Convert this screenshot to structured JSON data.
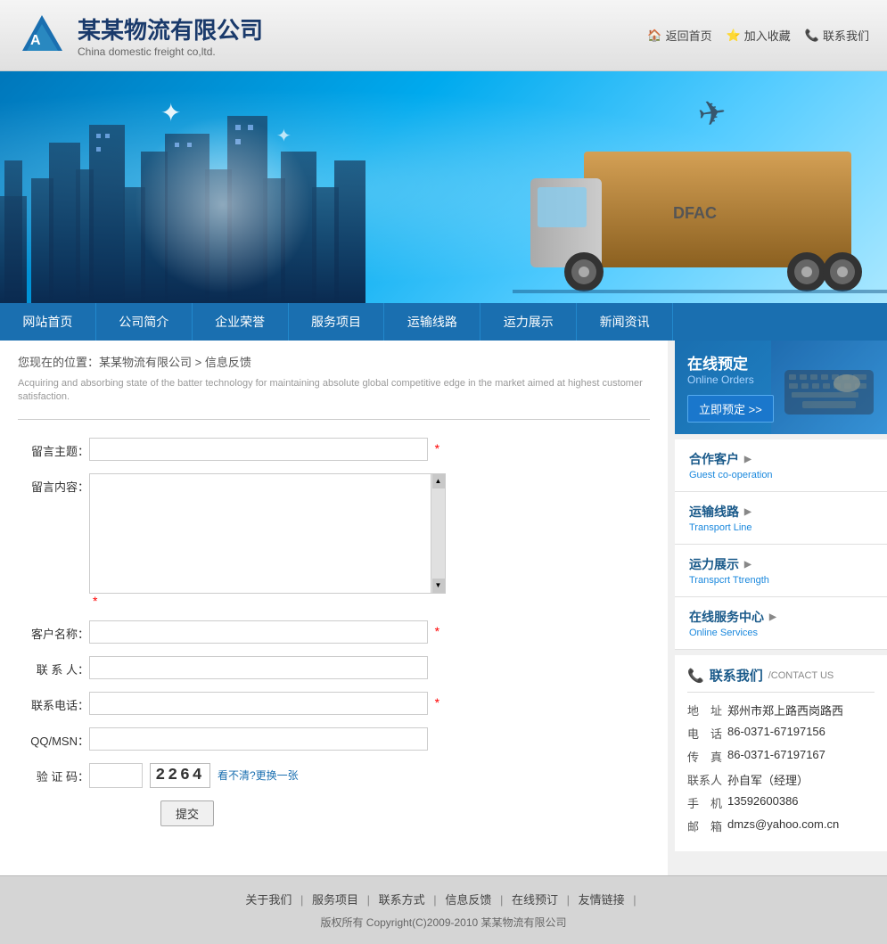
{
  "header": {
    "logo_text": "某某物流有限公司",
    "logo_subtitle": "China domestic freight co,ltd.",
    "top_nav": {
      "home": "返回首页",
      "favorites": "加入收藏",
      "contact": "联系我们"
    }
  },
  "nav": {
    "items": [
      {
        "label": "网站首页",
        "id": "home"
      },
      {
        "label": "公司简介",
        "id": "about"
      },
      {
        "label": "企业荣誉",
        "id": "honor"
      },
      {
        "label": "服务项目",
        "id": "services"
      },
      {
        "label": "运输线路",
        "id": "routes"
      },
      {
        "label": "运力展示",
        "id": "capacity"
      },
      {
        "label": "新闻资讯",
        "id": "news"
      }
    ]
  },
  "breadcrumb": {
    "text": "您现在的位置：某某物流有限公司 > 信息反馈",
    "subtitle": "Acquiring and absorbing state of the batter technology for maintaining absolute global competitive edge in the market aimed at highest customer satisfaction."
  },
  "form": {
    "subject_label": "留言主题：",
    "content_label": "留言内容：",
    "customer_label": "客户名称：",
    "contact_label": "联 系 人：",
    "phone_label": "联系电话：",
    "qq_label": "QQ/MSN：",
    "captcha_label": "验 证 码：",
    "captcha_value": "2264",
    "captcha_hint": "看不清?更换一张",
    "submit_label": "提交"
  },
  "sidebar": {
    "online_order": {
      "title": "在线预定",
      "subtitle": "Online Orders",
      "btn_label": "立即预定"
    },
    "links": [
      {
        "cn": "合作客户",
        "en": "Guest co-operation"
      },
      {
        "cn": "运输线路",
        "en": "Transport Line"
      },
      {
        "cn": "运力展示",
        "en": "Transpcrt Ttrength"
      },
      {
        "cn": "在线服务中心",
        "en": "Online Services"
      }
    ],
    "contact": {
      "title_cn": "联系我们",
      "title_en": "/CONTACT US",
      "rows": [
        {
          "key": "地　址",
          "val": "郑州市郑上路西岗路西"
        },
        {
          "key": "电　话",
          "val": "86-0371-67197156"
        },
        {
          "key": "传　真",
          "val": "86-0371-67197167"
        },
        {
          "key": "联系人",
          "val": "孙自军（经理）"
        },
        {
          "key": "手　机",
          "val": "13592600386"
        },
        {
          "key": "邮　箱",
          "val": "dmzs@yahoo.com.cn"
        }
      ]
    }
  },
  "footer": {
    "links": [
      "关于我们",
      "服务项目",
      "联系方式",
      "信息反馈",
      "在线预订",
      "友情链接"
    ],
    "copyright": "版权所有 Copyright(C)2009-2010 某某物流有限公司"
  }
}
